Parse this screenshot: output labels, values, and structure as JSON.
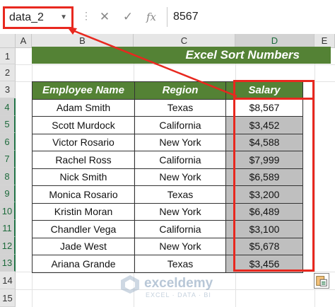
{
  "formula_bar": {
    "name_box": "data_2",
    "separator": "⋮",
    "cancel_icon": "✕",
    "enter_icon": "✓",
    "fx_icon": "fx",
    "formula": "8567"
  },
  "columns": [
    "A",
    "B",
    "C",
    "D",
    "E"
  ],
  "rows": [
    "1",
    "2",
    "3",
    "4",
    "5",
    "6",
    "7",
    "8",
    "9",
    "10",
    "11",
    "12",
    "13",
    "14",
    "15"
  ],
  "sheet": {
    "title": "Excel Sort Numbers",
    "headers": [
      "Employee Name",
      "Region",
      "Salary"
    ],
    "data": [
      [
        "Adam Smith",
        "Texas",
        "$8,567"
      ],
      [
        "Scott Murdock",
        "California",
        "$3,452"
      ],
      [
        "Victor Rosario",
        "New York",
        "$4,588"
      ],
      [
        "Rachel Ross",
        "California",
        "$7,999"
      ],
      [
        "Nick Smith",
        "New York",
        "$6,589"
      ],
      [
        "Monica Rosario",
        "Texas",
        "$3,200"
      ],
      [
        "Kristin Moran",
        "New York",
        "$6,489"
      ],
      [
        "Chandler Vega",
        "California",
        "$3,100"
      ],
      [
        "Jade West",
        "New York",
        "$5,678"
      ],
      [
        "Ariana Grande",
        "Texas",
        "$3,456"
      ]
    ]
  },
  "watermark": {
    "name": "exceldemy",
    "tagline": "EXCEL · DATA · BI"
  },
  "colors": {
    "green": "#548235",
    "highlight": "#e8281f",
    "selected_fill": "#bfbfbf"
  }
}
